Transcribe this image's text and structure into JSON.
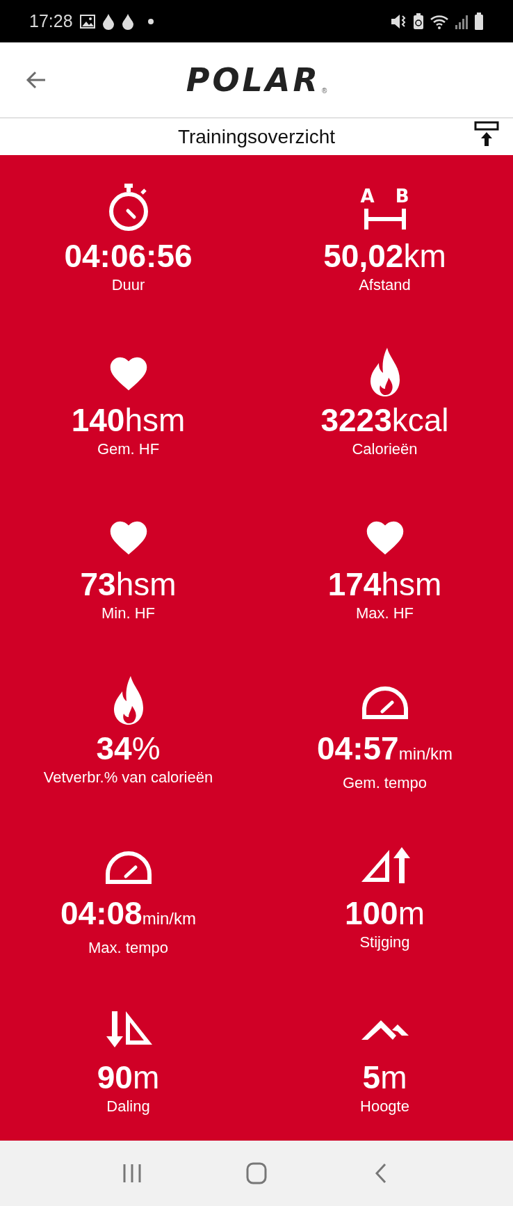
{
  "status_bar": {
    "time": "17:28"
  },
  "header": {
    "logo": "POLAR",
    "logo_mark": "®"
  },
  "title_bar": {
    "title": "Trainingsoverzicht"
  },
  "distance_icon_letters": [
    "A",
    "B"
  ],
  "stats": [
    {
      "kind": "stopwatch",
      "value": "04:06:56",
      "label": "Duur"
    },
    {
      "kind": "distance",
      "value": "50,02",
      "unit": "km",
      "label": "Afstand"
    },
    {
      "kind": "heart",
      "value": "140",
      "unit": "hsm",
      "label": "Gem. HF"
    },
    {
      "kind": "flame",
      "value": "3223",
      "unit": "kcal",
      "label": "Calorieën"
    },
    {
      "kind": "heart",
      "value": "73",
      "unit": "hsm",
      "label": "Min. HF"
    },
    {
      "kind": "heart",
      "value": "174",
      "unit": "hsm",
      "label": "Max. HF"
    },
    {
      "kind": "flame",
      "value": "34",
      "unit": "%",
      "label": "Vetverbr.% van calorieën"
    },
    {
      "kind": "gauge",
      "value": "04:57",
      "unit": "min/km",
      "label": "Gem. tempo"
    },
    {
      "kind": "gauge",
      "value": "04:08",
      "unit": "min/km",
      "label": "Max. tempo"
    },
    {
      "kind": "ascent",
      "value": "100",
      "unit": "m",
      "label": "Stijging"
    },
    {
      "kind": "descent",
      "value": "90",
      "unit": "m",
      "label": "Daling"
    },
    {
      "kind": "altitude",
      "value": "5",
      "unit": "m",
      "label": "Hoogte"
    }
  ]
}
